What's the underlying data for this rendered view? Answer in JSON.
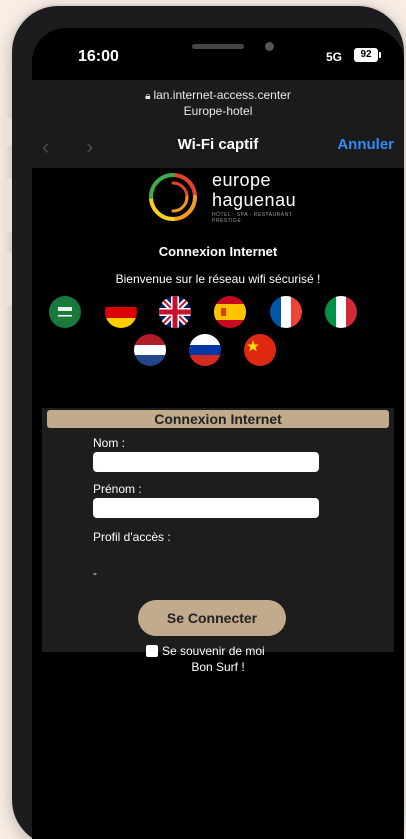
{
  "status": {
    "time": "16:00",
    "network": "5G",
    "battery": "92"
  },
  "browser": {
    "url": "lan.internet-access.center",
    "subtitle": "Europe-hotel",
    "title": "Wi-Fi captif",
    "cancel": "Annuler",
    "back_glyph": "‹",
    "forward_glyph": "›"
  },
  "logo": {
    "line1": "europe",
    "line2": "haguenau",
    "tagline": "HÔTEL · SPA · RESTAURANT · PRESTIGE"
  },
  "page": {
    "heading": "Connexion Internet",
    "welcome": "Bienvenue sur le réseau wifi sécurisé !",
    "flags": [
      "Arabic",
      "German",
      "English",
      "Spanish",
      "French",
      "Italian",
      "Dutch",
      "Russian",
      "Chinese"
    ]
  },
  "form": {
    "title": "Connexion Internet",
    "nom_label": "Nom  :",
    "nom_value": "",
    "prenom_label": "Prénom  :",
    "prenom_value": "",
    "profil_label": "Profil d'accès  :",
    "profil_value": "-",
    "submit": "Se Connecter",
    "remember": "Se souvenir de moi"
  },
  "footer": "Bon Surf !",
  "colors": {
    "accent": "#c2ab8c",
    "link": "#2f8cf5"
  }
}
